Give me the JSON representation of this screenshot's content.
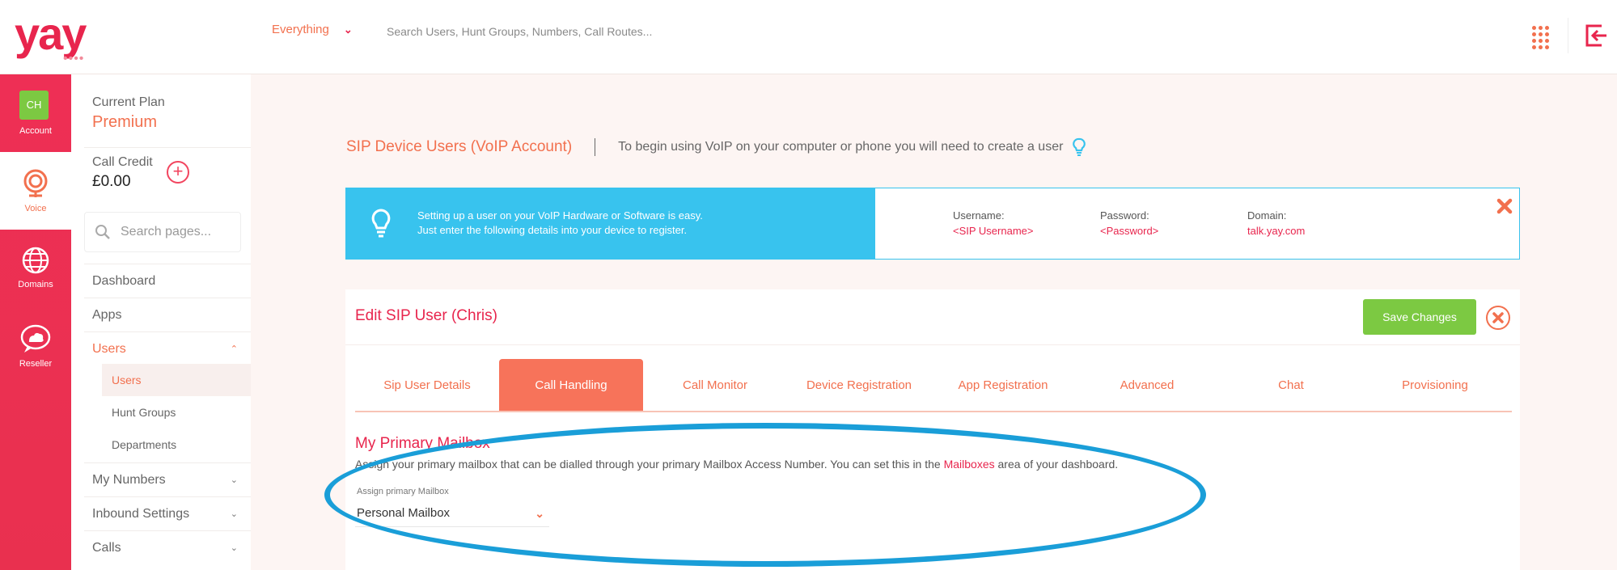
{
  "brand": {
    "logo_text": "yay",
    "logo_dots": "••••",
    "accent": "#e8254d",
    "orange": "#f2704e",
    "green": "#7cc942",
    "blue": "#38c3ee"
  },
  "topbar": {
    "filter_label": "Everything",
    "search_placeholder": "Search Users, Hunt Groups, Numbers, Call Routes...",
    "apps_icon": "grid-icon",
    "logout_icon": "logout-icon"
  },
  "rail": {
    "account": {
      "badge": "CH",
      "label": "Account"
    },
    "voice": {
      "label": "Voice"
    },
    "domains": {
      "label": "Domains"
    },
    "reseller": {
      "label": "Reseller"
    }
  },
  "sidebar": {
    "plan_label": "Current Plan",
    "plan_value": "Premium",
    "credit_label": "Call Credit",
    "credit_value": "£0.00",
    "search_placeholder": "Search pages...",
    "items": [
      {
        "label": "Dashboard"
      },
      {
        "label": "Apps"
      },
      {
        "label": "Users"
      },
      {
        "label": "My Numbers"
      },
      {
        "label": "Inbound Settings"
      },
      {
        "label": "Calls"
      }
    ],
    "subitems": [
      {
        "label": "Users"
      },
      {
        "label": "Hunt Groups"
      },
      {
        "label": "Departments"
      }
    ]
  },
  "page": {
    "title": "SIP Device Users (VoIP Account)",
    "subtitle": "To begin using VoIP on your computer or phone you will need to create a user"
  },
  "info": {
    "line1": "Setting up a user on your VoIP Hardware or Software is easy.",
    "line2": "Just enter the following details into your device to register.",
    "username_label": "Username:",
    "username_value": "<SIP Username>",
    "password_label": "Password:",
    "password_value": "<Password>",
    "domain_label": "Domain:",
    "domain_value": "talk.yay.com"
  },
  "edit": {
    "title": "Edit SIP User (Chris)",
    "save_label": "Save Changes",
    "tabs": [
      {
        "label": "Sip User Details"
      },
      {
        "label": "Call Handling"
      },
      {
        "label": "Call Monitor"
      },
      {
        "label": "Device Registration"
      },
      {
        "label": "App Registration"
      },
      {
        "label": "Advanced"
      },
      {
        "label": "Chat"
      },
      {
        "label": "Provisioning"
      }
    ],
    "active_tab": "Call Handling"
  },
  "mailbox": {
    "title": "My Primary Mailbox",
    "desc_before": "Assign your primary mailbox that can be dialled through your primary Mailbox Access Number. You can set this in the ",
    "desc_link": "Mailboxes",
    "desc_after": " area of your dashboard.",
    "field_label": "Assign primary Mailbox",
    "selected": "Personal Mailbox"
  }
}
